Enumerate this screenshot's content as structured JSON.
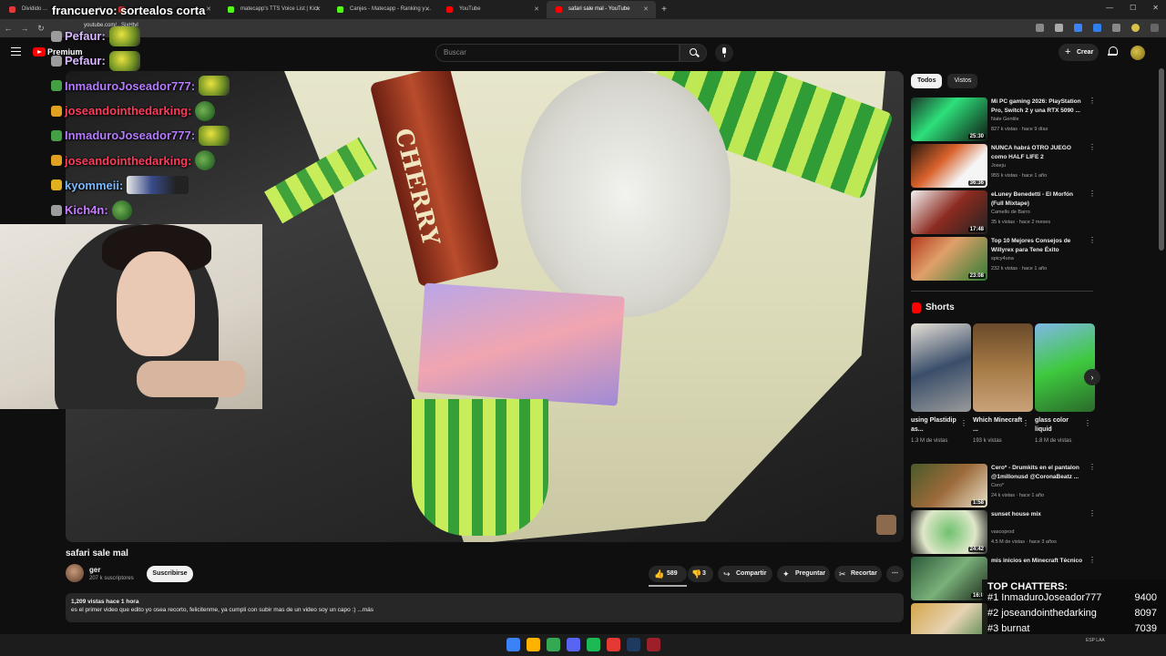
{
  "browser": {
    "tabs": [
      {
        "label": "Dividido ...",
        "color": "#e53935"
      },
      {
        "label": "",
        "color": "#e53935"
      },
      {
        "label": "matecapp's TTS Voice List | Kick",
        "color": "#53fc18"
      },
      {
        "label": "Canjes - Matecapp - Ranking y ...",
        "color": "#53fc18"
      },
      {
        "label": "YouTube",
        "color": "#ff0000"
      },
      {
        "label": "safari sale mal - YouTube",
        "color": "#ff0000"
      }
    ],
    "url": "youtube.com/...SjxHtyl"
  },
  "header": {
    "logo_text": "Premium",
    "search_placeholder": "Buscar",
    "create_label": "Crear"
  },
  "stream_overlay": {
    "title": "francuervo: sortealos corta",
    "chat": [
      {
        "name": "Pefaur:",
        "color": "#d9b8ff",
        "emote": "emote"
      },
      {
        "name": "Pefaur:",
        "color": "#d9b8ff",
        "emote": "emote"
      },
      {
        "name": "InmaduroJoseador777:",
        "color": "#b57bff",
        "emote": "emote"
      },
      {
        "name": "joseandointhedarking:",
        "color": "#ff3b5c",
        "emote": "pepe"
      },
      {
        "name": "InmaduroJoseador777:",
        "color": "#b57bff",
        "emote": "emote"
      },
      {
        "name": "joseandointhedarking:",
        "color": "#ff3b5c",
        "emote": "pepe"
      },
      {
        "name": "kyommeii:",
        "color": "#7ab8ff",
        "emote": "wide"
      },
      {
        "name": "Kich4n:",
        "color": "#c77dff",
        "emote": "pepe"
      }
    ],
    "top_chatters": {
      "title": "TOP CHATTERS:",
      "rows": [
        {
          "rank": "#1 InmaduroJoseador777",
          "value": "9400"
        },
        {
          "rank": "#2 joseandointhedarking",
          "value": "8097"
        },
        {
          "rank": "#3 burnat",
          "value": "7039"
        }
      ]
    }
  },
  "video": {
    "title": "safari sale mal",
    "channel": "ger",
    "subscribers": "207 k suscriptores",
    "subscribe_label": "Suscribirse",
    "likes": "589",
    "dislikes": "3",
    "share_label": "Compartir",
    "ask_label": "Preguntar",
    "clip_label": "Recortar",
    "can_label": "CHERRY",
    "description_meta": "1,209 vistas  hace 1 hora",
    "description": "es el primer video que edito yo osea recorto, felicitenme, ya cumpli con subir mas de un video soy un capo :) ...más"
  },
  "sidebar": {
    "chips": [
      "Todos",
      "Vistos"
    ],
    "recommended": [
      {
        "title": "Mi PC gaming 2026: PlayStation Pro, Switch 2 y una RTX 5090 ...",
        "channel": "Nate Gentile",
        "meta": "827 k vistas · hace 9 días",
        "duration": "25:30",
        "thumb": "linear-gradient(135deg,#1b3a2a,#2ee07a 40%,#0d1a12)"
      },
      {
        "title": "NUNCA habrá OTRO JUEGO como HALF LIFE 2",
        "channel": "Joseju",
        "meta": "955 k vistas · hace 1 año",
        "duration": "36:36",
        "thumb": "linear-gradient(135deg,#2a1a10,#d9622b 40%,#f5f5f5 70%)"
      },
      {
        "title": "eLuney Benedetti - El Morfón (Full Mixtape)",
        "channel": "Camello de Barro",
        "meta": "35 k vistas · hace 2 meses",
        "duration": "17:48",
        "thumb": "linear-gradient(135deg,#f1f1f1,#8c2b1f 50%,#222)"
      },
      {
        "title": "Top 10 Mejores Consejos de Willyrex para Tene Éxito",
        "channel": "spicy4una",
        "meta": "232 k vistas · hace 1 año",
        "duration": "23:08",
        "thumb": "linear-gradient(135deg,#b33a1f,#e0a06a 40%,#2e7c33)"
      },
      {
        "title": "Cero* - Drumkits en el pantalon @1millonusd @CoronaBeatz ...",
        "channel": "Cero*",
        "meta": "24 k vistas · hace 1 año",
        "duration": "1:58",
        "thumb": "linear-gradient(135deg,#4a5a2a,#9c6a3a 50%,#e8e0c8)"
      },
      {
        "title": "sunset house mix",
        "channel": "vascoprod",
        "meta": "4.5 M de vistas · hace 3 años",
        "duration": "24:42",
        "thumb": "radial-gradient(circle,#6ec26e,#dfe7c9 60%,#2e2e2e)"
      },
      {
        "title": "mis inicios en Minecraft Técnico",
        "channel": "",
        "meta": "",
        "duration": "16:0",
        "thumb": "linear-gradient(135deg,#2c5a3a,#7ab07a 50%,#1b2a1b)"
      },
      {
        "title": "",
        "channel": "",
        "meta": "",
        "duration": "",
        "thumb": "linear-gradient(135deg,#d4a64a,#e6d3b3 50%,#3a7a3a)"
      }
    ],
    "shorts_title": "Shorts",
    "shorts": [
      {
        "title": "using Plastidip as...",
        "views": "1.3 M de vistas",
        "thumb": "linear-gradient(160deg,#e6e0d6,#3a4e6a 50%,#9a9a9a)"
      },
      {
        "title": "Which Minecraft ...",
        "views": "193 k vistas",
        "thumb": "linear-gradient(180deg,#6a4a2a,#a57a45 50%,#c9a27a)"
      },
      {
        "title": "glass color liquid",
        "views": "1.8 M de vistas",
        "thumb": "linear-gradient(160deg,#7fb8e8,#3ec93e 50%,#2a6a2a)"
      }
    ]
  },
  "taskbar": {
    "icons": [
      "#3b82f6",
      "#ffb300",
      "#34a853",
      "#5865f2",
      "#1db954",
      "#e53935",
      "#1e3a5f",
      "#9c1f2a"
    ],
    "lang": "ESP LAA"
  }
}
